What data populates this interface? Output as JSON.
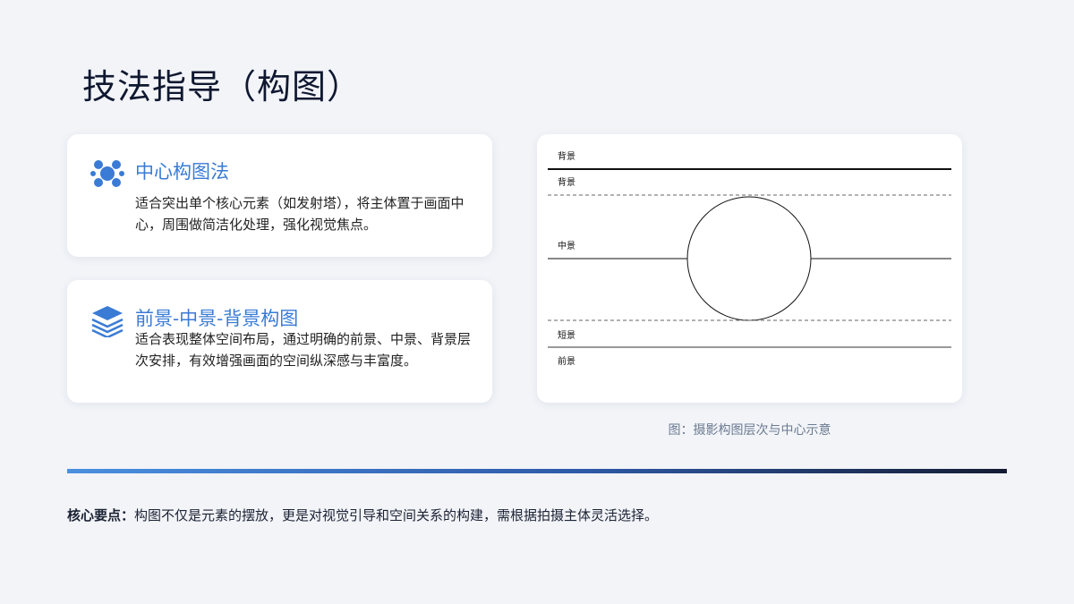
{
  "title": "技法指导（构图）",
  "cards": [
    {
      "icon": "center-composition-icon",
      "title": "中心构图法",
      "description": "适合突出单个核心元素（如发射塔），将主体置于画面中心，周围做简洁化处理，强化视觉焦点。"
    },
    {
      "icon": "layers-icon",
      "title": "前景-中景-背景构图",
      "description": "适合表现整体空间布局，通过明确的前景、中景、背景层次安排，有效增强画面的空间纵深感与丰富度。"
    }
  ],
  "diagram": {
    "labels": {
      "top_background": "背景",
      "background": "背景",
      "midground": "中景",
      "short": "短景",
      "foreground": "前景"
    }
  },
  "caption": "图：摄影构图层次与中心示意",
  "key_point": {
    "lead": "核心要点：",
    "text": "构图不仅是元素的摆放，更是对视觉引导和空间关系的构建，需根据拍摄主体灵活选择。"
  },
  "colors": {
    "accent": "#3a7bd5",
    "background": "#f2f4f8",
    "divider_start": "#4a8fe0",
    "divider_end": "#141c33"
  }
}
